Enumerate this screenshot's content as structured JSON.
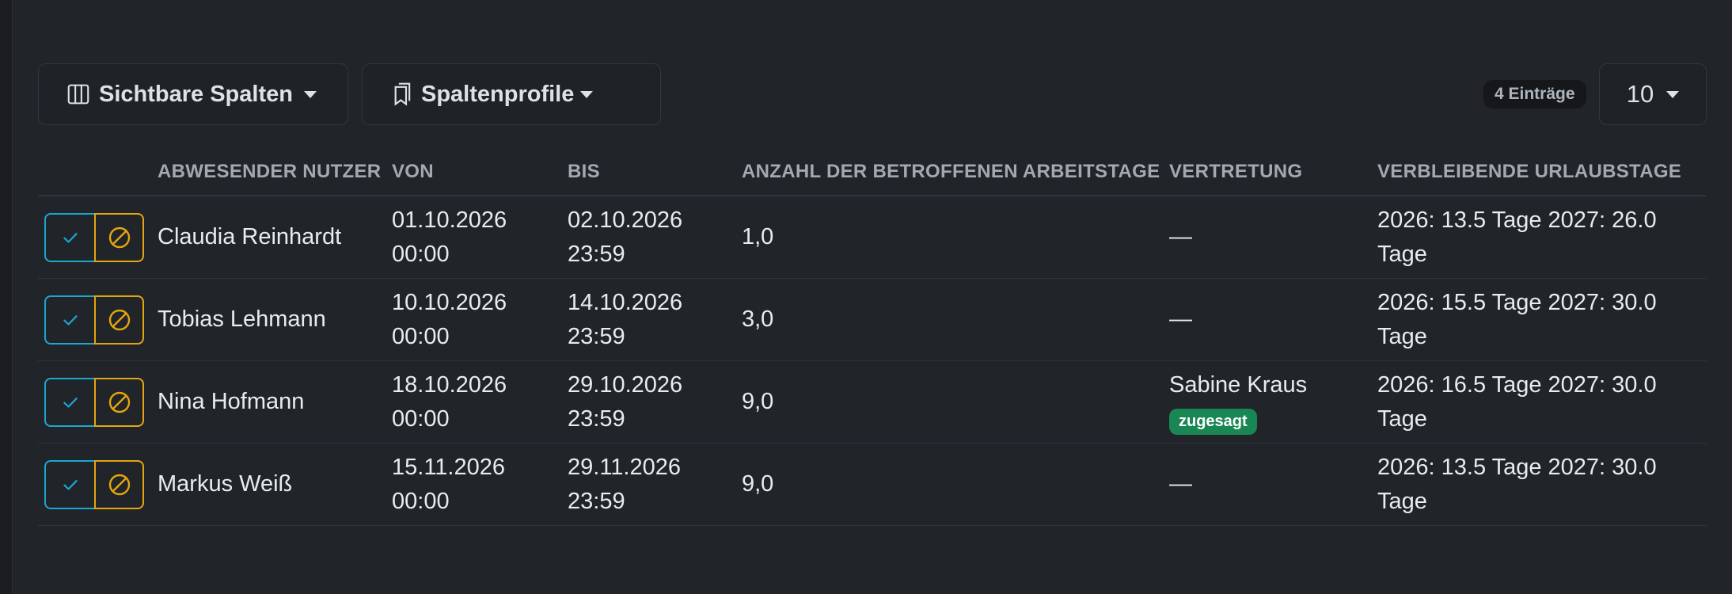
{
  "toolbar": {
    "visible_columns_label": "Sichtbare Spalten",
    "column_profiles_label": "Spaltenprofile",
    "entries_count": "4 Einträge",
    "page_size": "10"
  },
  "table": {
    "headers": {
      "user": "ABWESENDER NUTZER",
      "from": "VON",
      "to": "BIS",
      "workdays": "ANZAHL DER BETROFFENEN ARBEITSTAGE",
      "substitute": "VERTRETUNG",
      "remaining": "VERBLEIBENDE URLAUBSTAGE"
    },
    "rows": [
      {
        "user": "Claudia Reinhardt",
        "from_date": "01.10.2026",
        "from_time": "00:00",
        "to_date": "02.10.2026",
        "to_time": "23:59",
        "workdays": "1,0",
        "substitute": "—",
        "substitute_status": "",
        "remaining_line1": "2026: 13.5 Tage 2027: 26.0",
        "remaining_line2": "Tage"
      },
      {
        "user": "Tobias Lehmann",
        "from_date": "10.10.2026",
        "from_time": "00:00",
        "to_date": "14.10.2026",
        "to_time": "23:59",
        "workdays": "3,0",
        "substitute": "—",
        "substitute_status": "",
        "remaining_line1": "2026: 15.5 Tage 2027: 30.0",
        "remaining_line2": "Tage"
      },
      {
        "user": "Nina Hofmann",
        "from_date": "18.10.2026",
        "from_time": "00:00",
        "to_date": "29.10.2026",
        "to_time": "23:59",
        "workdays": "9,0",
        "substitute": "Sabine Kraus",
        "substitute_status": "zugesagt",
        "remaining_line1": "2026: 16.5 Tage 2027: 30.0",
        "remaining_line2": "Tage"
      },
      {
        "user": "Markus Weiß",
        "from_date": "15.11.2026",
        "from_time": "00:00",
        "to_date": "29.11.2026",
        "to_time": "23:59",
        "workdays": "9,0",
        "substitute": "—",
        "substitute_status": "",
        "remaining_line1": "2026: 13.5 Tage 2027: 30.0",
        "remaining_line2": "Tage"
      }
    ]
  },
  "colors": {
    "background": "#212429",
    "approve": "#1ba7d2",
    "deny": "#e4a60f",
    "success_badge": "#198754"
  },
  "icons": {
    "visible_columns": "columns-icon",
    "column_profiles": "bookmarks-icon",
    "approve": "check-icon",
    "deny": "ban-icon"
  }
}
